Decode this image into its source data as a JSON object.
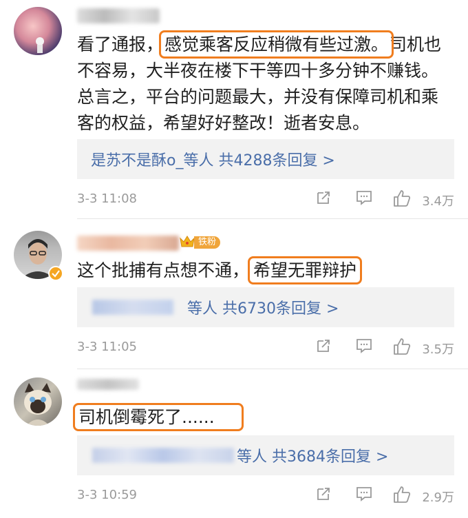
{
  "comments": [
    {
      "text_before": "看了通报，",
      "text_highlight": "感觉乘客反应稍微有些过激。",
      "text_after": "司机也不容易，大半夜在楼下干等四十多分钟不赚钱。总言之，平台的问题最大，并没有保障司机和乘客的权益，希望好好整改！逝者安息。",
      "reply_summary": "是苏不是酥o_等人 共4288条回复 >",
      "time": "3-3 11:08",
      "likes": "3.4万"
    },
    {
      "badge": "铁粉",
      "text_before": "这个批捕有点想不通，",
      "text_highlight": "希望无罪辩护",
      "reply_summary": "等人 共6730条回复 >",
      "time": "3-3 11:05",
      "likes": "3.5万"
    },
    {
      "text_highlight": "司机倒霉死了......",
      "reply_summary": "等人 共3684条回复 >",
      "time": "3-3 10:59",
      "likes": "2.9万"
    }
  ]
}
